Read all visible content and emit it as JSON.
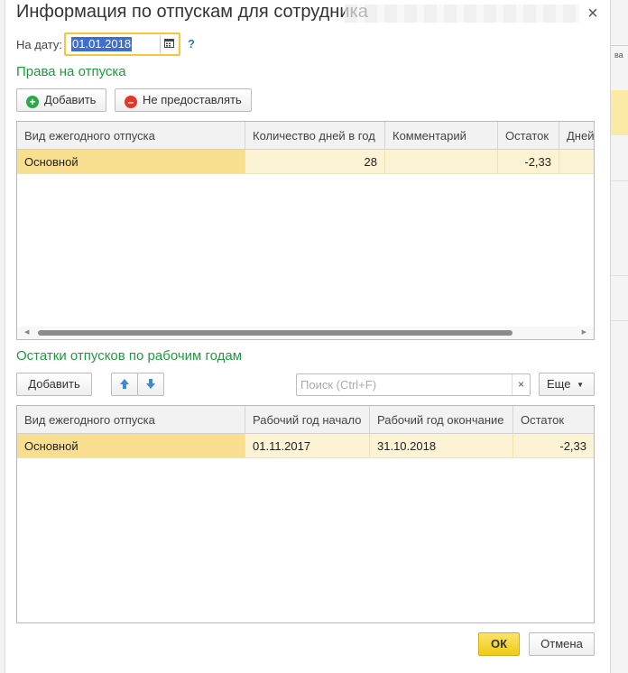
{
  "window": {
    "title": "Информация по отпускам для сотрудника",
    "close_icon": "close-icon"
  },
  "date_field": {
    "label": "На дату:",
    "value": "01.01.2018",
    "calendar_icon": "calendar-icon",
    "help_label": "?"
  },
  "rights_section": {
    "title": "Права на отпуска",
    "add_label": "Добавить",
    "deny_label": "Не предоставлять",
    "columns": [
      "Вид ежегодного отпуска",
      "Количество дней в год",
      "Комментарий",
      "Остаток",
      "Дней"
    ],
    "rows": [
      {
        "type": "Основной",
        "days_per_year": "28",
        "comment": "",
        "remainder": "-2,33",
        "days": ""
      }
    ]
  },
  "balances_section": {
    "title": "Остатки отпусков по рабочим годам",
    "add_label": "Добавить",
    "search_placeholder": "Поиск (Ctrl+F)",
    "search_clear": "×",
    "more_label": "Еще",
    "columns": [
      "Вид ежегодного отпуска",
      "Рабочий год начало",
      "Рабочий год окончание",
      "Остаток"
    ],
    "rows": [
      {
        "type": "Основной",
        "year_start": "01.11.2017",
        "year_end": "31.10.2018",
        "remainder": "-2,33"
      }
    ]
  },
  "footer": {
    "ok_label": "ОК",
    "cancel_label": "Отмена"
  },
  "colors": {
    "section_title": "#1d9c3e",
    "selected_row": "#fbf3d3",
    "selected_cell": "#f8df8f",
    "ok_button": "#f5d21b",
    "focus_border": "#f4c838"
  }
}
